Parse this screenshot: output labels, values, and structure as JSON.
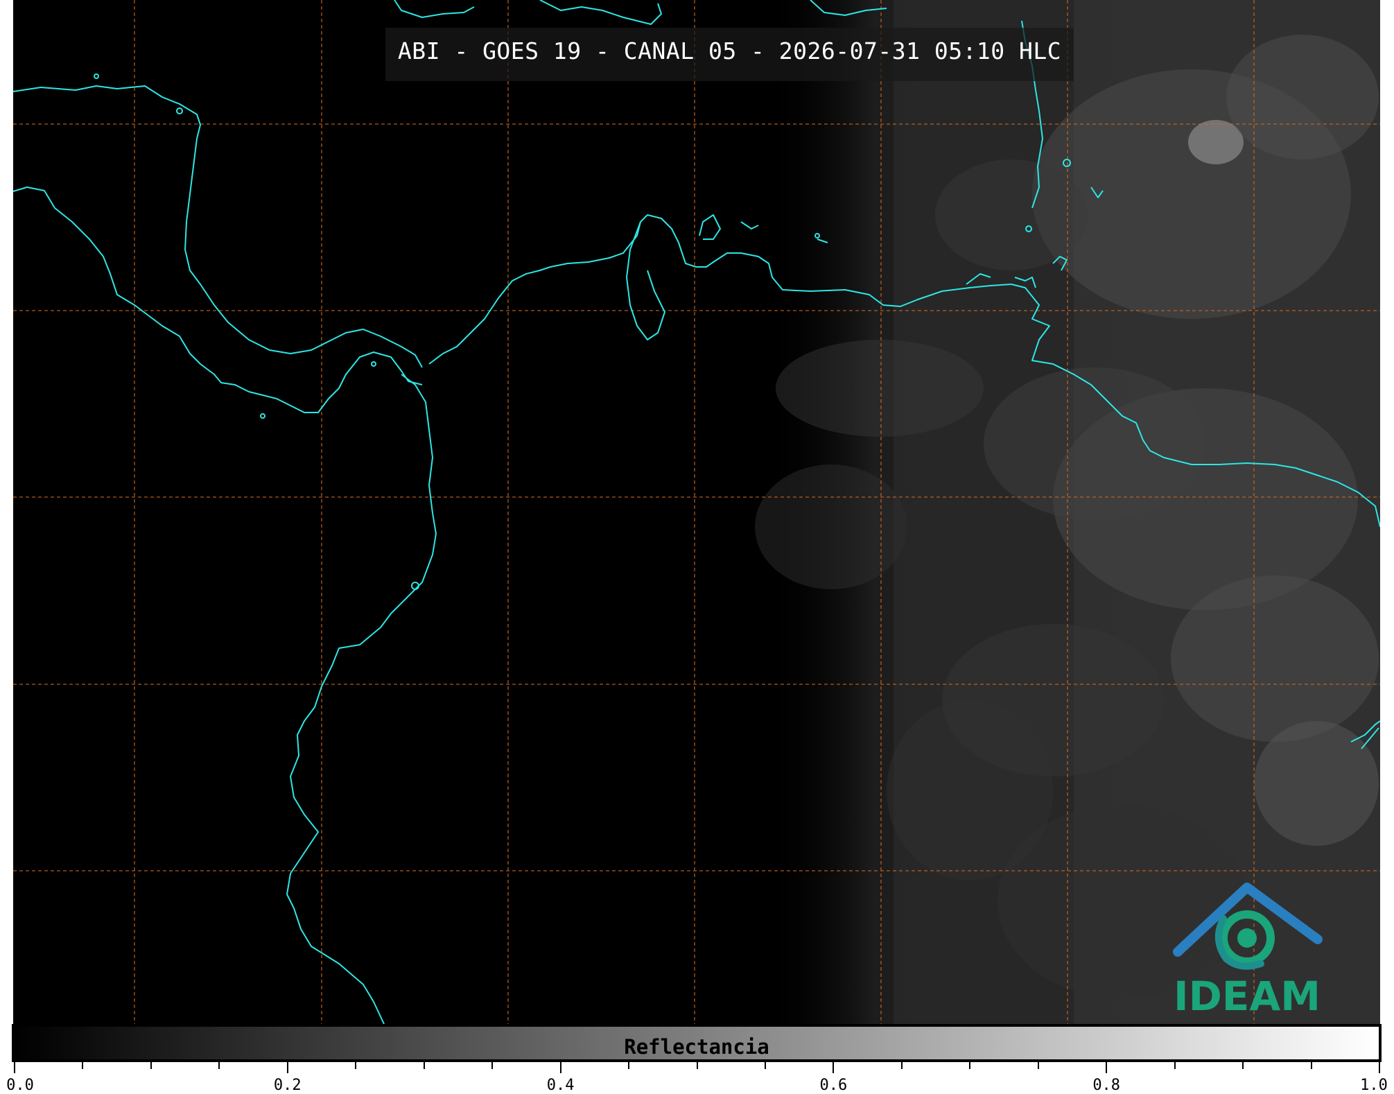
{
  "title": "ABI - GOES 19 - CANAL 05 - 2026-07-31 05:10 HLC",
  "colorbar": {
    "label": "Reflectancia",
    "ticks": [
      "0.0",
      "0.2",
      "0.4",
      "0.6",
      "0.8",
      "1.0"
    ],
    "range": [
      0.0,
      1.0
    ],
    "colors": [
      "#000000",
      "#ffffff"
    ]
  },
  "logo": {
    "text": "IDEAM"
  },
  "colors": {
    "coastline": "#2ee6e6",
    "gridlines": "#d2691e",
    "background": "#000000",
    "logo_blue": "#2a7fc0",
    "logo_green": "#1aa57a"
  }
}
